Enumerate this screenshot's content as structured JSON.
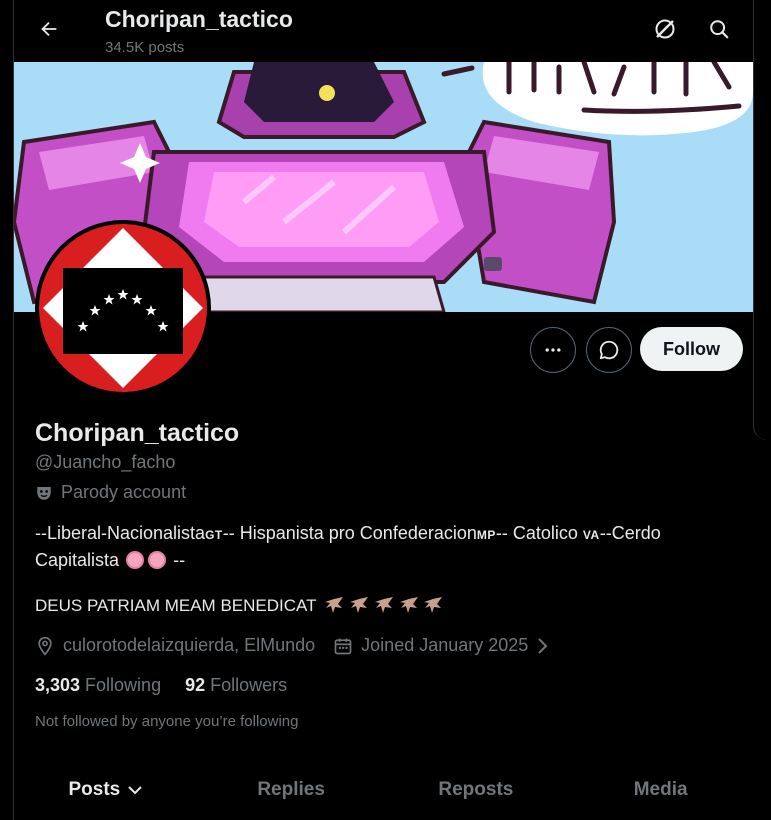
{
  "header": {
    "title": "Choripan_tactico",
    "posts_count": "34.5K posts",
    "back_icon": "arrow-left-icon",
    "grok_icon": "grok-icon",
    "search_icon": "search-icon"
  },
  "actions": {
    "more_icon": "more-horizontal-icon",
    "message_icon": "message-icon",
    "follow_label": "Follow"
  },
  "profile": {
    "display_name": "Choripan_tactico",
    "handle": "@Juancho_facho",
    "parody_label": "Parody account",
    "bio_line1_a": "--Liberal-Nacionalista",
    "bio_gt": "GT",
    "bio_line1_b": "-- Hispanista pro Confederacion",
    "bio_mp": "MP",
    "bio_line1_c": "-- Catolico ",
    "bio_va": "VA",
    "bio_line1_d": "--Cerdo",
    "bio_line2_a": "Capitalista",
    "bio_line2_b": "--",
    "motto": "DEUS PATRIAM MEAM BENEDICAT",
    "location": "culorotodelaizquierda, ElMundo",
    "joined": "Joined January 2025",
    "following_count": "3,303",
    "following_label": "Following",
    "followers_count": "92",
    "followers_label": "Followers",
    "not_followed": "Not followed by anyone you’re following"
  },
  "tabs": [
    {
      "label": "Posts",
      "active": true
    },
    {
      "label": "Replies",
      "active": false
    },
    {
      "label": "Reposts",
      "active": false
    },
    {
      "label": "Media",
      "active": false
    }
  ],
  "colors": {
    "background": "#000000",
    "text_primary": "#e7e9ea",
    "text_secondary": "#71767b",
    "follow_button_bg": "#eff3f4",
    "banner_sky": "#a8dcf7",
    "robot_purple": "#c060c8",
    "avatar_red": "#d81e1e"
  }
}
